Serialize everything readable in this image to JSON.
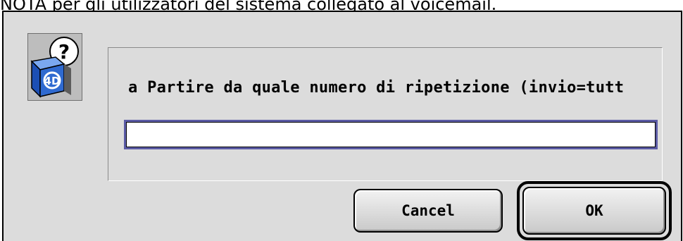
{
  "background_text": "NOTA per gli utilizzatori del sistema collegato al voicemail.",
  "dialog": {
    "prompt": "a Partire da quale numero di ripetizione (invio=tutt",
    "input_value": "",
    "cancel_label": "Cancel",
    "ok_label": "OK",
    "icon": "4d-question-icon"
  },
  "colors": {
    "dialog_bg": "#dcdcdc",
    "field_focus_ring": "#5b5ba5",
    "icon_blue": "#2f6ad0"
  }
}
